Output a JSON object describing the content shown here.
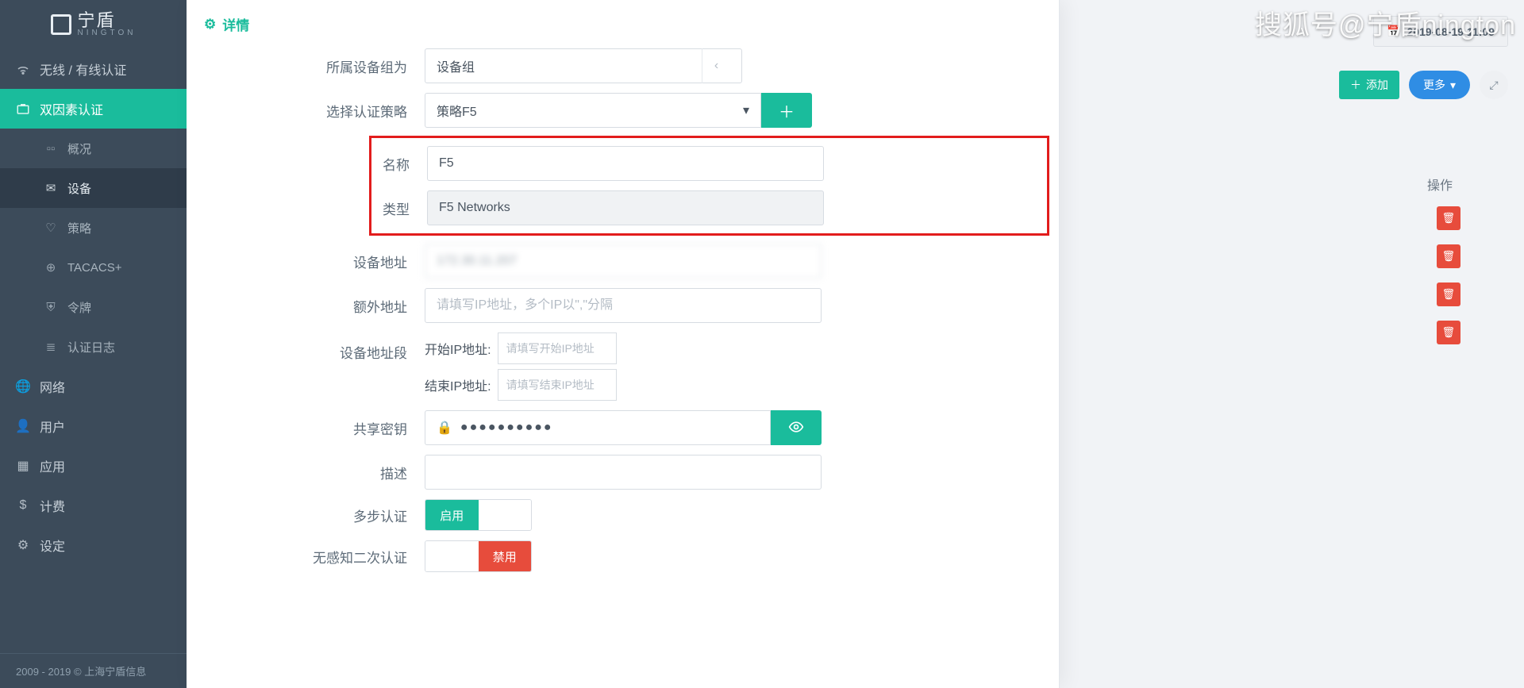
{
  "brand": {
    "name": "宁盾",
    "sub": "NINGTON"
  },
  "watermark": "搜狐号@宁盾nington",
  "sidebar": {
    "items": [
      {
        "label": "无线 / 有线认证"
      },
      {
        "label": "双因素认证"
      }
    ],
    "sub": [
      {
        "label": "概况"
      },
      {
        "label": "设备"
      },
      {
        "label": "策略"
      },
      {
        "label": "TACACS+"
      },
      {
        "label": "令牌"
      },
      {
        "label": "认证日志"
      }
    ],
    "bottom": [
      {
        "label": "网络"
      },
      {
        "label": "用户"
      },
      {
        "label": "应用"
      },
      {
        "label": "计费"
      },
      {
        "label": "设定"
      }
    ],
    "footer": "2009 - 2019 © 上海宁盾信息"
  },
  "page": {
    "datetime": "2019-08-19 11:09",
    "add": "添加",
    "more": "更多",
    "ops_header": "操作"
  },
  "modal": {
    "title": "详情",
    "labels": {
      "group": "所属设备组为",
      "policy": "选择认证策略",
      "name": "名称",
      "type": "类型",
      "addr": "设备地址",
      "extra_addr": "额外地址",
      "range": "设备地址段",
      "range_start": "开始IP地址:",
      "range_end": "结束IP地址:",
      "secret": "共享密钥",
      "desc": "描述",
      "multistep": "多步认证",
      "silent2fa": "无感知二次认证"
    },
    "values": {
      "group": "设备组",
      "policy": "策略F5",
      "name": "F5",
      "type": "F5 Networks",
      "addr": "172.30.11.207",
      "secret": "●●●●●●●●●●"
    },
    "placeholders": {
      "extra_addr": "请填写IP地址，多个IP以\",\"分隔",
      "range_start": "请填写开始IP地址",
      "range_end": "请填写结束IP地址"
    },
    "toggles": {
      "enable": "启用",
      "disable": "禁用"
    }
  }
}
